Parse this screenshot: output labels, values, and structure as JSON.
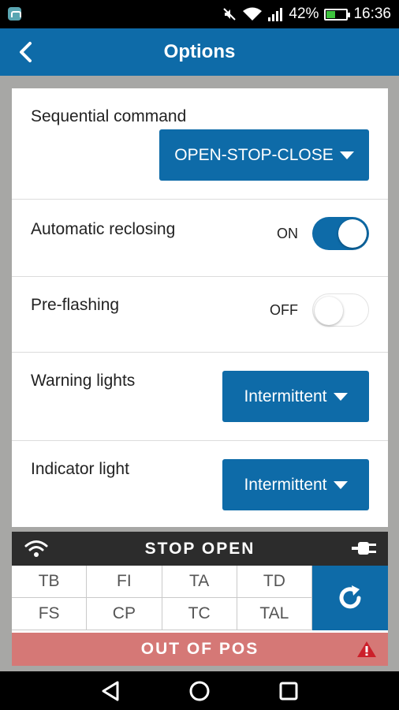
{
  "status_bar": {
    "battery_percent": "42%",
    "battery_level": 0.42,
    "time": "16:36",
    "icons": [
      "app-notification-icon",
      "mute-icon",
      "wifi-icon",
      "signal-icon",
      "battery-icon"
    ]
  },
  "header": {
    "title": "Options",
    "back_icon": "chevron-left-icon"
  },
  "options": {
    "sequential_command": {
      "label": "Sequential command",
      "value": "OPEN-STOP-CLOSE"
    },
    "automatic_reclosing": {
      "label": "Automatic reclosing",
      "state": "ON",
      "enabled": true
    },
    "pre_flashing": {
      "label": "Pre-flashing",
      "state": "OFF",
      "enabled": false
    },
    "warning_lights": {
      "label": "Warning lights",
      "value": "Intermittent"
    },
    "indicator_light": {
      "label": "Indicator light",
      "value": "Intermittent"
    }
  },
  "status_panel": {
    "title": "STOP OPEN",
    "grid": [
      "TB",
      "FI",
      "TA",
      "TD",
      "FS",
      "CP",
      "TC",
      "TAL"
    ],
    "alert": "OUT OF POS"
  },
  "colors": {
    "primary": "#0e6ba8",
    "alert": "#d57876",
    "warning_icon": "#cc1f2a",
    "battery": "#3ec43e"
  }
}
